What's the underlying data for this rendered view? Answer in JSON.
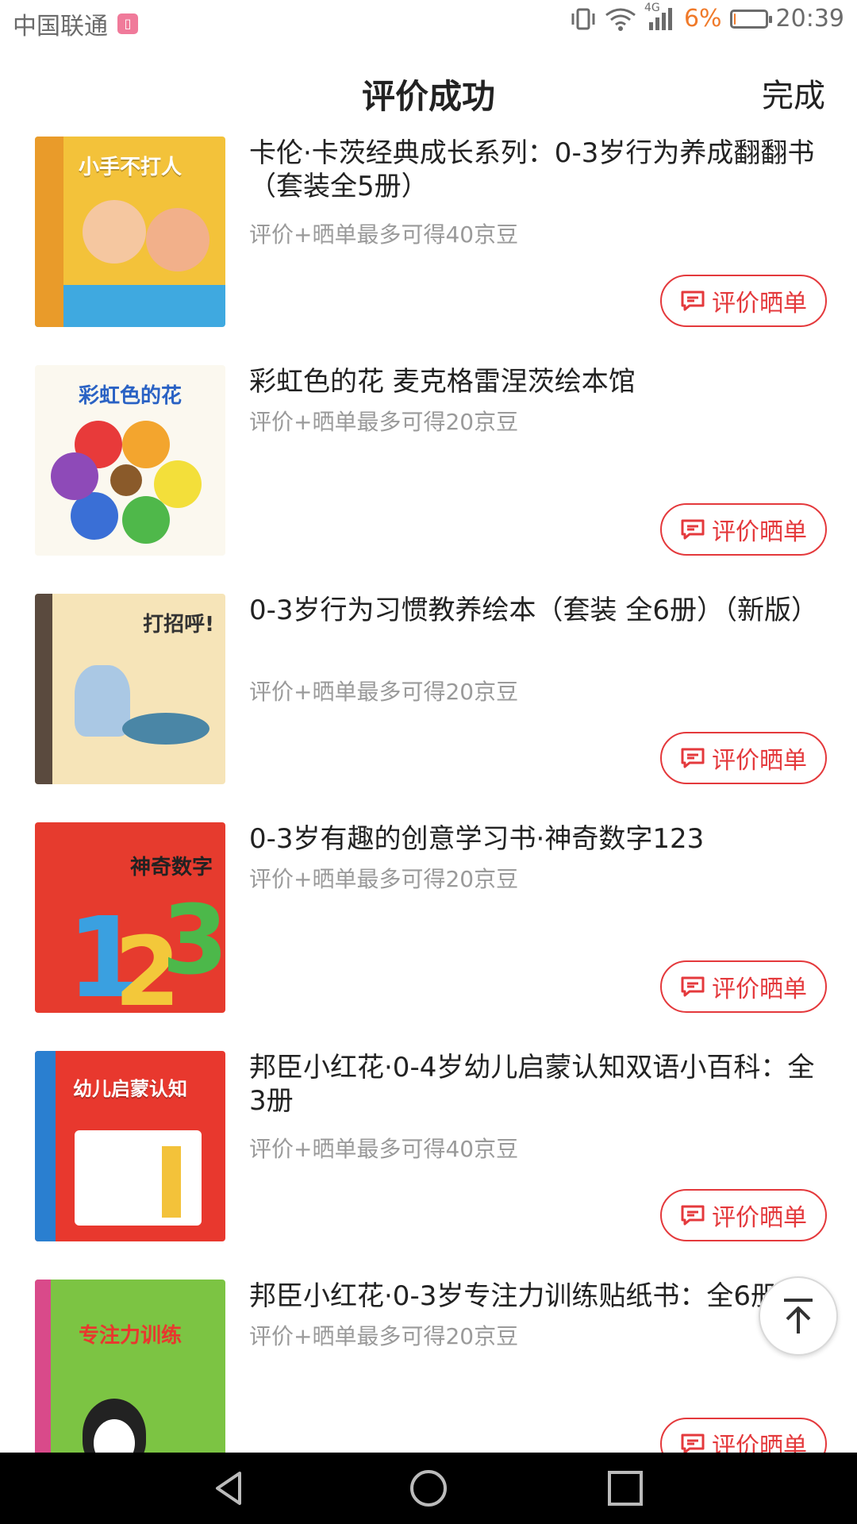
{
  "status": {
    "carrier": "中国联通",
    "network": "4G",
    "battery_percent": "6%",
    "battery_level": 0.06,
    "time": "20:39"
  },
  "header": {
    "title": "评价成功",
    "done_label": "完成"
  },
  "products": [
    {
      "name": "卡伦·卡茨经典成长系列：0-3岁行为养成翻翻书（套装全5册）",
      "reward": "评价+晒单最多可得40京豆",
      "button": "评价晒单",
      "cover_text": "小手不打人"
    },
    {
      "name": "彩虹色的花 麦克格雷涅茨绘本馆",
      "reward": "评价+晒单最多可得20京豆",
      "button": "评价晒单",
      "cover_text": "彩虹色的花"
    },
    {
      "name": "0-3岁行为习惯教养绘本（套装 全6册）（新版）",
      "reward": "评价+晒单最多可得20京豆",
      "button": "评价晒单",
      "cover_text": "打招呼!"
    },
    {
      "name": "0-3岁有趣的创意学习书·神奇数字123",
      "reward": "评价+晒单最多可得20京豆",
      "button": "评价晒单",
      "cover_text": "神奇数字"
    },
    {
      "name": "邦臣小红花·0-4岁幼儿启蒙认知双语小百科：全3册",
      "reward": "评价+晒单最多可得40京豆",
      "button": "评价晒单",
      "cover_text": "幼儿启蒙认知"
    },
    {
      "name": "邦臣小红花·0-3岁专注力训练贴纸书：全6册",
      "reward": "评价+晒单最多可得20京豆",
      "button": "评价晒单",
      "cover_text": "专注力训练"
    }
  ],
  "colors": {
    "accent": "#e4393c",
    "muted_text": "#9a9a9a",
    "battery_low": "#f07a2a"
  }
}
